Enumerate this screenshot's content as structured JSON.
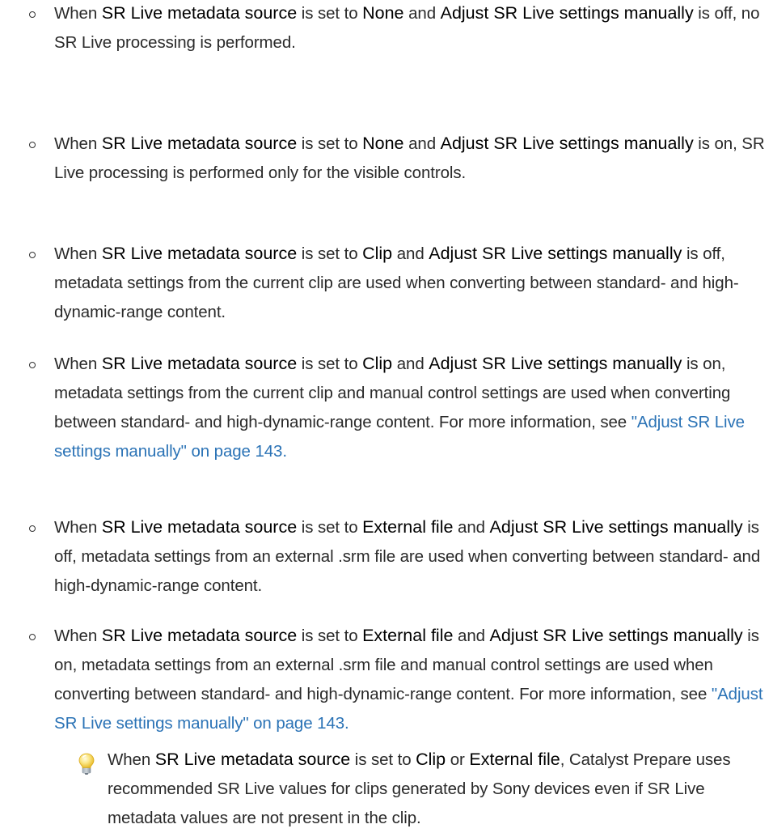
{
  "terms": {
    "source": "SR Live metadata source",
    "manual": "Adjust SR Live settings manually",
    "manual_a": "Adjust SR Live",
    "manual_b": "settings manually",
    "manual_c": "Adjust SR Live settings",
    "manual_d": "manually",
    "none": "None",
    "clip": "Clip",
    "external": "External file"
  },
  "items": [
    {
      "w1": "When ",
      "s1": " is set to ",
      "s2": " and ",
      "rest": " is off, no SR Live processing is performed."
    },
    {
      "w1": "When ",
      "s1": " is set to ",
      "s2": " and ",
      "rest": " is on, SR Live processing is performed only for the visible controls."
    },
    {
      "w1": "When ",
      "s1": " is set to ",
      "s2": " and ",
      "rest": " is off, metadata settings from the current clip are used when converting between standard- and high-dynamic-range content."
    },
    {
      "w1": "When ",
      "s1": " is set to ",
      "s2": " and ",
      "rest": " is on, metadata settings from the current clip and manual control settings are used when converting between standard- and high-dynamic-range content. For more information, see ",
      "link": "\"Adjust SR Live settings manually\" on page 143.",
      "after": ""
    },
    {
      "w1": "When ",
      "s1": " is set to ",
      "s2": " and ",
      "rest": " is off, metadata settings from an external .srm file are used when converting between standard- and high-dynamic-range content."
    },
    {
      "w1": "When ",
      "s1": " is set to ",
      "s2": " and ",
      "rest": " is on, metadata settings from an external .srm file and manual control settings are used when converting between standard- and high-dynamic-range content. For more information, see ",
      "link": "\"Adjust SR Live settings manually\" on page 143.",
      "after": ""
    }
  ],
  "tip": {
    "w1": "When ",
    "s1": " is set to ",
    "or": " or ",
    "rest": ", Catalyst Prepare uses recommended SR Live values for clips generated by Sony devices even if SR Live metadata values are not present in the clip."
  },
  "icons": {
    "tip": "lightbulb-icon",
    "bullet": "hollow-circle-bullet"
  },
  "colors": {
    "link": "#2b73b6",
    "text": "#2a2a2a"
  }
}
